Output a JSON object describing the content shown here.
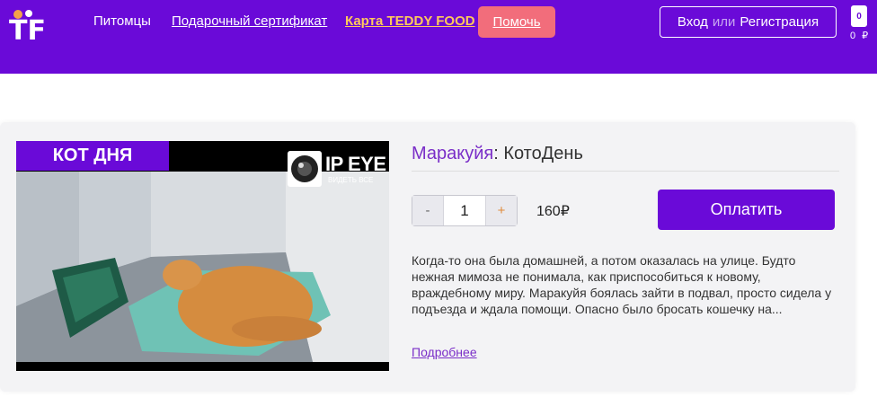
{
  "header": {
    "logo_text": "TF",
    "nav": {
      "pets": "Питомцы",
      "certificate": "Подарочный сертификат",
      "food_card": "Карта TEDDY FOOD",
      "help": "Помочь"
    },
    "auth": {
      "login": "Вход",
      "or": "или",
      "register": "Регистрация"
    },
    "cart": {
      "count": "0",
      "sum": "0 ₽"
    }
  },
  "product": {
    "badge": "КОТ ДНЯ",
    "watermark": {
      "brand": "IP EYE",
      "tagline": "ВИДЕТЬ ВСЕ"
    },
    "title_name": "Маракуйя",
    "title_rest": ": КотоДень",
    "quantity": {
      "minus": "-",
      "value": "1",
      "plus": "+"
    },
    "price": "160₽",
    "pay_label": "Оплатить",
    "description": "Когда-то она была домашней, а потом оказалась на улице. Будто нежная мимоза не понимала, как приспособиться к новому, враждебному миру. Маракуйя боялась зайти в подвал, просто сидела у подъезда и ждала помощи. Опасно было бросать кошечку на...",
    "more_link": "Подробнее"
  },
  "colors": {
    "brand_purple": "#6a0ad8",
    "help_pink": "#f26d7b",
    "food_yellow": "#ffc85c",
    "name_purple": "#7a2ec8"
  },
  "icons": {
    "cart": "shopping-bag-icon",
    "camera": "camera-lens-icon"
  }
}
